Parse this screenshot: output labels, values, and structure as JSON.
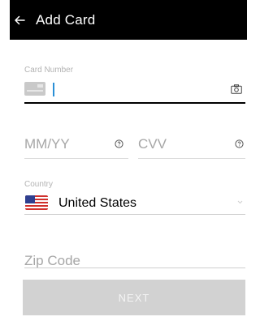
{
  "header": {
    "title": "Add Card",
    "back_icon": "arrow-left-icon"
  },
  "card_number": {
    "label": "Card Number",
    "value": "",
    "brand_icon": "generic-card-icon",
    "scan_icon": "camera-icon"
  },
  "expiry": {
    "placeholder": "MM/YY",
    "help_icon": "question-circle-icon"
  },
  "cvv": {
    "placeholder": "CVV",
    "help_icon": "question-circle-icon"
  },
  "country": {
    "label": "Country",
    "value": "United States",
    "flag_icon": "us-flag-icon",
    "dropdown_icon": "chevron-down-icon"
  },
  "zip": {
    "placeholder": "Zip Code"
  },
  "next_button": {
    "label": "NEXT"
  },
  "colors": {
    "header_bg": "#000000",
    "cursor": "#2a8fd6",
    "button_disabled": "#d2d2d2"
  }
}
